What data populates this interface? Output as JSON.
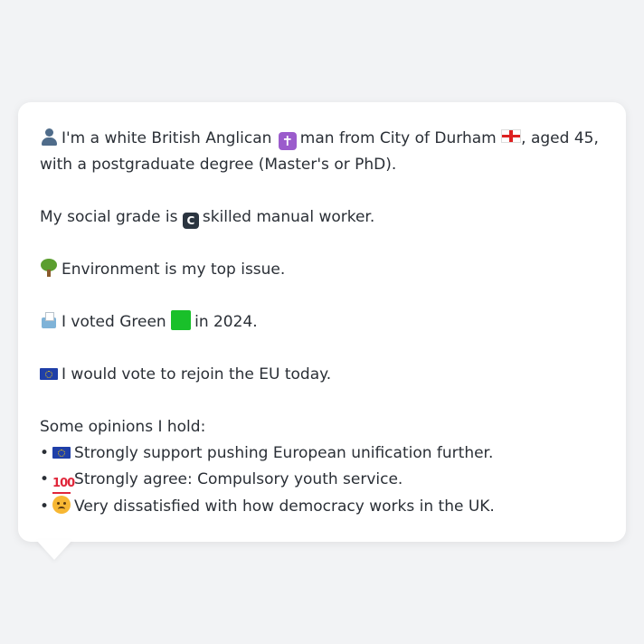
{
  "profile": {
    "intro_line1": "I'm a white British Anglican",
    "intro_line1b": "man from City of Durham",
    "intro_line1c": ", aged 45,",
    "intro_line2": "with a postgraduate degree (Master's or PhD).",
    "social_grade_pre": "My social grade is",
    "social_grade_badge": "C",
    "social_grade_post": "skilled manual worker.",
    "top_issue": "Environment is my top issue.",
    "vote_pre": "I voted Green",
    "vote_post": "in 2024.",
    "eu_vote": "I would vote to rejoin the EU today.",
    "opinions_heading": "Some opinions I hold:",
    "opinions": [
      "Strongly support pushing European unification further.",
      "Strongly agree: Compulsory youth service.",
      "Very dissatisfied with how democracy works in the UK."
    ],
    "bullet": "•",
    "cross_glyph": "✝",
    "hundred_glyph": "100"
  },
  "icons": {
    "person": "person-icon",
    "cross": "latin-cross-icon",
    "england_flag": "england-flag-icon",
    "c_badge": "letter-c-icon",
    "tree": "tree-icon",
    "ballot": "ballot-box-icon",
    "green_square": "green-square-icon",
    "eu_flag": "eu-flag-icon",
    "hundred": "hundred-points-icon",
    "angry": "angry-face-icon"
  },
  "colors": {
    "background": "#f2f3f5",
    "bubble": "#ffffff",
    "text": "#2a2f36",
    "green": "#19c02a"
  }
}
